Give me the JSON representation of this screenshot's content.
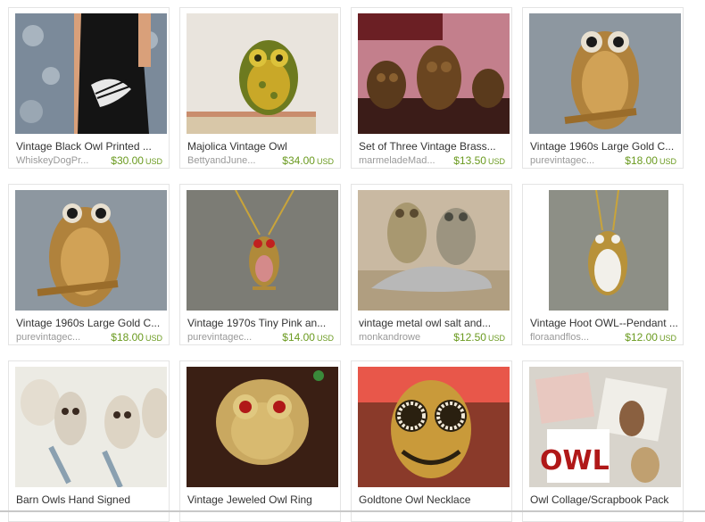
{
  "listings": [
    {
      "title": "Vintage Black Owl Printed ...",
      "shop": "WhiskeyDogPr...",
      "price": "$30.00",
      "currency": "USD",
      "image": "black-owl-dress-photo"
    },
    {
      "title": "Majolica Vintage Owl",
      "shop": "BettyandJune...",
      "price": "$34.00",
      "currency": "USD",
      "image": "majolica-owl-photo"
    },
    {
      "title": "Set of Three Vintage Brass...",
      "shop": "marmeladeMad...",
      "price": "$13.50",
      "currency": "USD",
      "image": "brass-owls-photo"
    },
    {
      "title": "Vintage 1960s Large Gold C...",
      "shop": "purevintagec...",
      "price": "$18.00",
      "currency": "USD",
      "image": "gold-owl-brooch-photo"
    },
    {
      "title": "Vintage 1960s Large Gold C...",
      "shop": "purevintagec...",
      "price": "$18.00",
      "currency": "USD",
      "image": "gold-owl-brooch-photo-2"
    },
    {
      "title": "Vintage 1970s Tiny Pink an...",
      "shop": "purevintagec...",
      "price": "$14.00",
      "currency": "USD",
      "image": "pink-owl-necklace-photo"
    },
    {
      "title": "vintage metal owl salt and...",
      "shop": "monkandrowe",
      "price": "$12.50",
      "currency": "USD",
      "image": "metal-owl-salt-pepper-photo"
    },
    {
      "title": "Vintage Hoot OWL--Pendant ...",
      "shop": "floraandflos...",
      "price": "$12.00",
      "currency": "USD",
      "image": "white-owl-pendant-photo"
    },
    {
      "title": "Barn Owls Hand Signed",
      "shop": "",
      "price": "",
      "currency": "",
      "image": "barn-owls-painting-photo"
    },
    {
      "title": "Vintage Jeweled Owl Ring",
      "shop": "",
      "price": "",
      "currency": "",
      "image": "jeweled-owl-ring-photo"
    },
    {
      "title": "Goldtone Owl Necklace",
      "shop": "",
      "price": "",
      "currency": "",
      "image": "goldtone-owl-necklace-photo"
    },
    {
      "title": "Owl Collage/Scrapbook Pack",
      "shop": "",
      "price": "",
      "currency": "",
      "image": "owl-collage-photo"
    }
  ],
  "colors": {
    "price": "#6a9a1f",
    "title": "#333333",
    "shop": "#999999",
    "card_border": "#e4e4e4"
  }
}
